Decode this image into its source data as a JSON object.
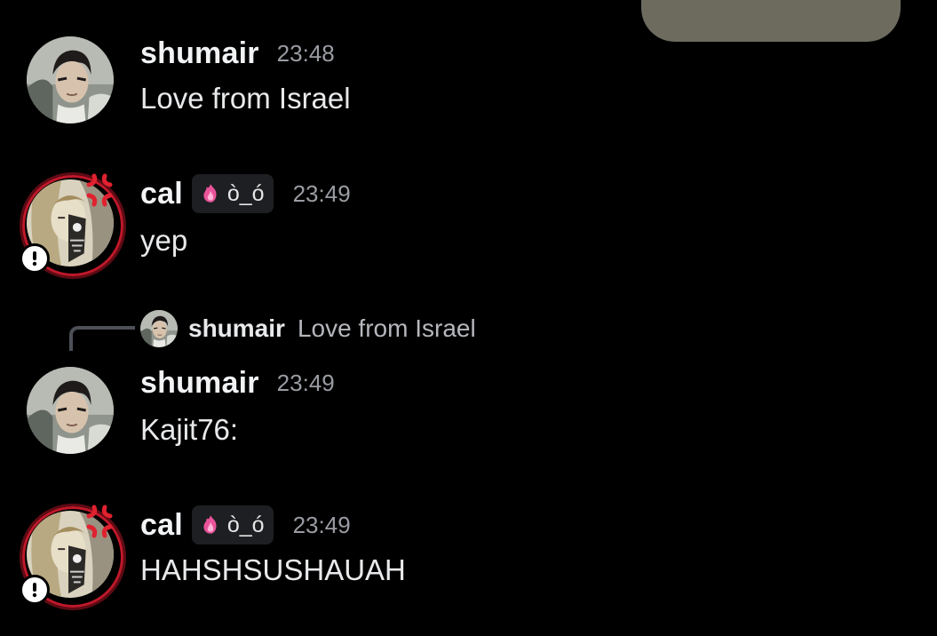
{
  "colors": {
    "background": "#000000",
    "username": "#f2f3f5",
    "timestamp": "#9a9ca3",
    "message_text": "#e8e9eb",
    "tag_background": "#1e1f22",
    "reply_line": "#4e5058",
    "avatar_ring": "#c0182a",
    "top_panel": "#6c6b5e"
  },
  "messages": [
    {
      "author": "shumair",
      "time": "23:48",
      "text": "Love from Israel",
      "avatar_icon": "anime-man-avatar"
    },
    {
      "author": "cal",
      "tag": "ò_ó",
      "tag_icon": "pink-flame-icon",
      "time": "23:49",
      "text": "yep",
      "avatar_icon": "skull-portrait-avatar",
      "decoration_icon": "anger-symbol-icon",
      "status_icon": "exclamation-badge-icon"
    },
    {
      "reply": {
        "author": "shumair",
        "text": "Love from Israel"
      },
      "author": "shumair",
      "time": "23:49",
      "text": "Kajit76:",
      "avatar_icon": "anime-man-avatar"
    },
    {
      "author": "cal",
      "tag": "ò_ó",
      "tag_icon": "pink-flame-icon",
      "time": "23:49",
      "text": "HAHSHSUSHAUAH",
      "avatar_icon": "skull-portrait-avatar",
      "decoration_icon": "anger-symbol-icon",
      "status_icon": "exclamation-badge-icon"
    }
  ]
}
